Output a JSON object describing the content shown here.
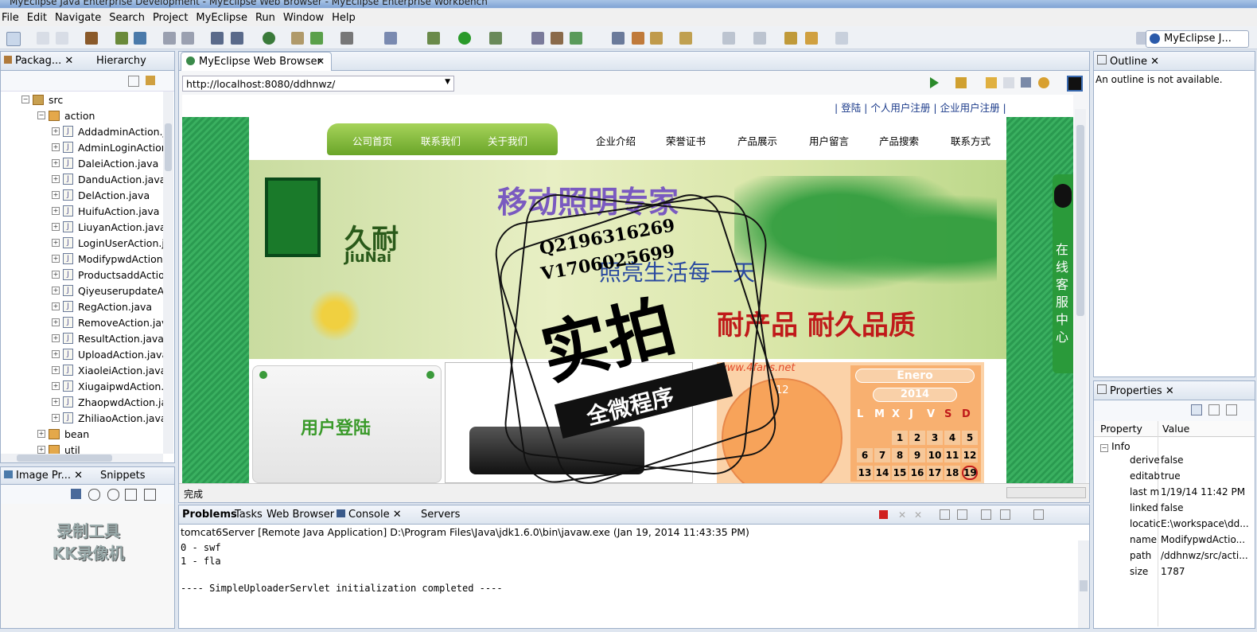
{
  "window": {
    "title": "MyEclipse Java Enterprise Development - MyEclipse Web Browser - MyEclipse Enterprise Workbench"
  },
  "menu": [
    "File",
    "Edit",
    "Navigate",
    "Search",
    "Project",
    "MyEclipse",
    "Run",
    "Window",
    "Help"
  ],
  "perspective": "MyEclipse J...",
  "left_panel": {
    "tabs": [
      "Packag...",
      "Hierarchy"
    ],
    "tree": {
      "src": "src",
      "action": "action",
      "files": [
        "AddadminAction.j",
        "AdminLoginAction",
        "DaleiAction.java",
        "DanduAction.java",
        "DelAction.java",
        "HuifuAction.java",
        "LiuyanAction.java",
        "LoginUserAction.j",
        "ModifypwdAction",
        "ProductsaddActio",
        "QiyeuserupdateA",
        "RegAction.java",
        "RemoveAction.jav",
        "ResultAction.java",
        "UploadAction.java",
        "XiaoleiAction.java",
        "XiugaipwdAction.j",
        "ZhaopwdAction.ja",
        "ZhiliaoAction.java"
      ],
      "bean": "bean",
      "util": "util"
    }
  },
  "image_panel": {
    "tabs": [
      "Image Pr...",
      "Snippets"
    ],
    "watermark_line1": "录制工具",
    "watermark_line2": "KK录像机"
  },
  "browser": {
    "tab": "MyEclipse Web Browser",
    "url": "http://localhost:8080/ddhnwz/",
    "status": "完成",
    "page": {
      "top_links": [
        "登陆",
        "个人用户注册",
        "企业用户注册"
      ],
      "nav_green": [
        "公司首页",
        "联系我们",
        "关于我们"
      ],
      "nav_plain": [
        "企业介绍",
        "荣誉证书",
        "产品展示",
        "用户留言",
        "产品搜索",
        "联系方式"
      ],
      "banner_heading": "移动照明专家",
      "logo_text": "久耐",
      "logo_sub": "JiuNai",
      "slogan": "照亮生活每一天",
      "tagline": "耐产品 耐久品质",
      "login_box_title": "用户登陆",
      "site_url": "www.4fans.net",
      "side_widget": "在线客服中心",
      "calendar": {
        "month": "Enero",
        "year": "2014",
        "days_header": [
          "L",
          "M",
          "X",
          "J",
          "V",
          "S",
          "D"
        ],
        "rows": [
          [
            "",
            "",
            "",
            "1",
            "2",
            "3",
            "4",
            "5"
          ],
          [
            "6",
            "7",
            "8",
            "9",
            "10",
            "11",
            "12"
          ],
          [
            "13",
            "14",
            "15",
            "16",
            "17",
            "18",
            "19"
          ]
        ]
      },
      "clock": {
        "top": "12"
      }
    },
    "stamp": {
      "qq": "Q2196316269",
      "vx": "V1706025699",
      "main": "实拍",
      "sub": "全微程序"
    }
  },
  "outline": {
    "tab": "Outline",
    "message": "An outline is not available."
  },
  "properties": {
    "tab": "Properties",
    "header": [
      "Property",
      "Value"
    ],
    "group": "Info",
    "rows": [
      [
        "derive",
        "false"
      ],
      [
        "editab",
        "true"
      ],
      [
        "last m",
        "1/19/14 11:42 PM"
      ],
      [
        "linked",
        "false"
      ],
      [
        "locatic",
        "E:\\workspace\\dd..."
      ],
      [
        "name",
        "ModifypwdActio..."
      ],
      [
        "path",
        "/ddhnwz/src/acti..."
      ],
      [
        "size",
        "1787"
      ]
    ]
  },
  "bottom": {
    "tabs": [
      "Problems",
      "Tasks",
      "Web Browser",
      "Console",
      "Servers"
    ],
    "console_header": "tomcat6Server [Remote Java Application] D:\\Program Files\\Java\\jdk1.6.0\\bin\\javaw.exe (Jan 19, 2014 11:43:35 PM)",
    "console_lines": [
      "0 - swf",
      "1 - fla",
      "",
      "---- SimpleUploaderServlet initialization completed ----"
    ]
  }
}
